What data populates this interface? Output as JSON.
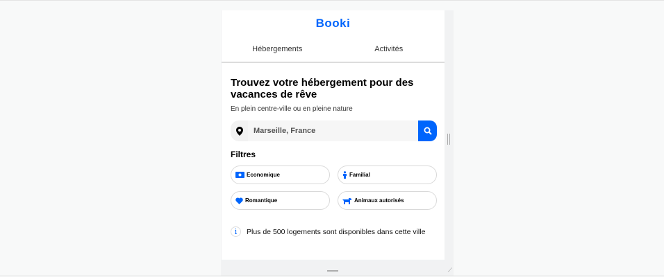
{
  "logo": "Booki",
  "tabs": [
    "Hébergements",
    "Activités"
  ],
  "title": "Trouvez votre hébergement pour des vacances de rêve",
  "subtitle": "En plein centre-ville ou en pleine nature",
  "search": {
    "value": "Marseille, France"
  },
  "filters_title": "Filtres",
  "filters": [
    "Economique",
    "Familial",
    "Romantique",
    "Animaux autorisés"
  ],
  "info": "Plus de 500 logements sont disponibles dans cette ville",
  "colors": {
    "accent": "#0065fc"
  }
}
